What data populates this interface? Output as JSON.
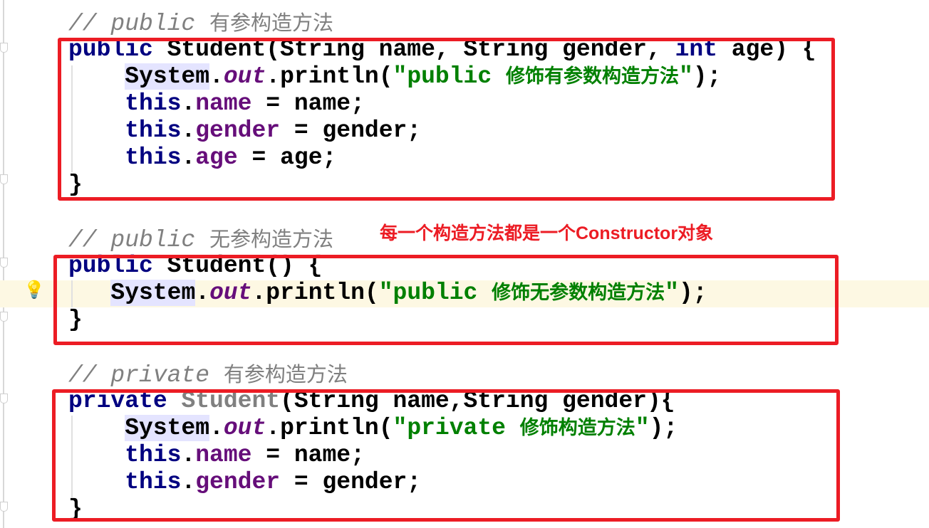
{
  "editor": {
    "colors": {
      "keyword": "#000080",
      "field": "#660e7a",
      "string": "#008000",
      "comment": "#808080",
      "annotation": "#ec1c24",
      "current_line": "#fdf8e3"
    },
    "intention_icon": "lightbulb-icon",
    "lines": [
      {
        "tokens": [
          {
            "t": "// public ",
            "c": "comment"
          },
          {
            "t": "有参构造方法",
            "c": "comment-cn"
          }
        ]
      },
      {
        "tokens": [
          {
            "t": "public",
            "c": "kw"
          },
          {
            "t": " Student(String name, String gender, ",
            "c": "plain"
          },
          {
            "t": "int",
            "c": "kw"
          },
          {
            "t": " age) {",
            "c": "plain"
          }
        ]
      },
      {
        "tokens": [
          {
            "t": "    ",
            "c": "plain"
          },
          {
            "t": "System",
            "c": "sys"
          },
          {
            "t": ".",
            "c": "plain"
          },
          {
            "t": "out",
            "c": "static"
          },
          {
            "t": ".println(",
            "c": "plain"
          },
          {
            "t": "\"public ",
            "c": "str"
          },
          {
            "t": "修饰有参数构造方法",
            "c": "str cn"
          },
          {
            "t": "\"",
            "c": "str"
          },
          {
            "t": ");",
            "c": "plain"
          }
        ]
      },
      {
        "tokens": [
          {
            "t": "    ",
            "c": "plain"
          },
          {
            "t": "this",
            "c": "kw"
          },
          {
            "t": ".",
            "c": "plain"
          },
          {
            "t": "name",
            "c": "field"
          },
          {
            "t": " = name;",
            "c": "plain"
          }
        ]
      },
      {
        "tokens": [
          {
            "t": "    ",
            "c": "plain"
          },
          {
            "t": "this",
            "c": "kw"
          },
          {
            "t": ".",
            "c": "plain"
          },
          {
            "t": "gender",
            "c": "field"
          },
          {
            "t": " = gender;",
            "c": "plain"
          }
        ]
      },
      {
        "tokens": [
          {
            "t": "    ",
            "c": "plain"
          },
          {
            "t": "this",
            "c": "kw"
          },
          {
            "t": ".",
            "c": "plain"
          },
          {
            "t": "age",
            "c": "field"
          },
          {
            "t": " = age;",
            "c": "plain"
          }
        ]
      },
      {
        "tokens": [
          {
            "t": "}",
            "c": "plain"
          }
        ]
      },
      {
        "tokens": []
      },
      {
        "tokens": [
          {
            "t": "// public ",
            "c": "comment"
          },
          {
            "t": "无参构造方法",
            "c": "comment-cn"
          }
        ]
      },
      {
        "tokens": [
          {
            "t": "public",
            "c": "kw"
          },
          {
            "t": " Student() {",
            "c": "plain"
          }
        ]
      },
      {
        "tokens": [
          {
            "t": "   ",
            "c": "plain"
          },
          {
            "t": "System",
            "c": "sys"
          },
          {
            "t": ".",
            "c": "plain"
          },
          {
            "t": "out",
            "c": "static"
          },
          {
            "t": ".println(",
            "c": "plain"
          },
          {
            "t": "\"public ",
            "c": "str"
          },
          {
            "t": "修饰无参数构造方法",
            "c": "str cn"
          },
          {
            "t": "\"",
            "c": "str"
          },
          {
            "t": ");",
            "c": "plain"
          }
        ]
      },
      {
        "tokens": [
          {
            "t": "}",
            "c": "plain"
          }
        ]
      },
      {
        "tokens": []
      },
      {
        "tokens": [
          {
            "t": "// private ",
            "c": "comment"
          },
          {
            "t": "有参构造方法",
            "c": "comment-cn"
          }
        ]
      },
      {
        "tokens": [
          {
            "t": "private",
            "c": "kw"
          },
          {
            "t": " ",
            "c": "plain"
          },
          {
            "t": "Student",
            "c": "unused"
          },
          {
            "t": "(String name,String gender){",
            "c": "plain"
          }
        ]
      },
      {
        "tokens": [
          {
            "t": "    ",
            "c": "plain"
          },
          {
            "t": "System",
            "c": "sys"
          },
          {
            "t": ".",
            "c": "plain"
          },
          {
            "t": "out",
            "c": "static"
          },
          {
            "t": ".println(",
            "c": "plain"
          },
          {
            "t": "\"private ",
            "c": "str"
          },
          {
            "t": "修饰构造方法",
            "c": "str cn"
          },
          {
            "t": "\"",
            "c": "str"
          },
          {
            "t": ");",
            "c": "plain"
          }
        ]
      },
      {
        "tokens": [
          {
            "t": "    ",
            "c": "plain"
          },
          {
            "t": "this",
            "c": "kw"
          },
          {
            "t": ".",
            "c": "plain"
          },
          {
            "t": "name",
            "c": "field"
          },
          {
            "t": " = name;",
            "c": "plain"
          }
        ]
      },
      {
        "tokens": [
          {
            "t": "    ",
            "c": "plain"
          },
          {
            "t": "this",
            "c": "kw"
          },
          {
            "t": ".",
            "c": "plain"
          },
          {
            "t": "gender",
            "c": "field"
          },
          {
            "t": " = gender;",
            "c": "plain"
          }
        ]
      },
      {
        "tokens": [
          {
            "t": "}",
            "c": "plain"
          }
        ]
      }
    ]
  },
  "annotation": {
    "note": "每一个构造方法都是一个Constructor对象"
  }
}
